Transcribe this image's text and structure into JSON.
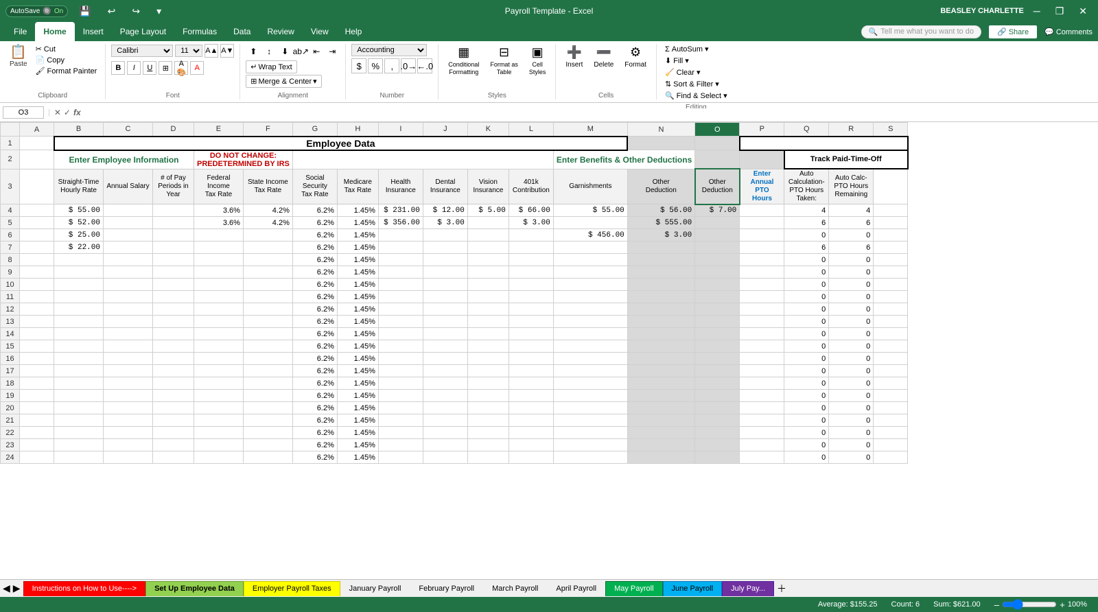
{
  "titlebar": {
    "autosave_label": "AutoSave",
    "autosave_state": "On",
    "title": "Payroll Template - Excel",
    "user": "BEASLEY CHARLETTE"
  },
  "tabs": [
    "File",
    "Home",
    "Insert",
    "Page Layout",
    "Formulas",
    "Data",
    "Review",
    "View",
    "Help"
  ],
  "active_tab": "Home",
  "search_placeholder": "Tell me what you want to do",
  "ribbon": {
    "clipboard": {
      "label": "Clipboard",
      "paste": "Paste",
      "cut": "Cut",
      "copy": "Copy",
      "format_painter": "Format Painter"
    },
    "font": {
      "label": "Font",
      "name": "Calibri",
      "size": "11"
    },
    "alignment": {
      "label": "Alignment",
      "wrap_text": "Wrap Text",
      "merge_center": "Merge & Center"
    },
    "number": {
      "label": "Number",
      "format": "Accounting"
    },
    "styles": {
      "label": "Styles",
      "conditional": "Conditional Formatting",
      "format_table": "Format as Table",
      "cell_styles": "Cell Styles"
    },
    "cells": {
      "label": "Cells",
      "insert": "Insert",
      "delete": "Delete",
      "format": "Format"
    },
    "editing": {
      "label": "Editing",
      "autosum": "AutoSum",
      "fill": "Fill",
      "clear": "Clear",
      "sort_filter": "Sort & Filter",
      "find_select": "Find & Select"
    }
  },
  "formula_bar": {
    "cell_ref": "O3",
    "formula": ""
  },
  "columns": [
    "B",
    "C",
    "D",
    "E",
    "F",
    "G",
    "H",
    "I",
    "J",
    "K",
    "L",
    "M",
    "N",
    "O",
    "P",
    "Q",
    "R",
    "S"
  ],
  "rows": [
    1,
    2,
    3,
    4,
    5,
    6,
    7,
    8,
    9,
    10,
    11,
    12,
    13,
    14,
    15,
    16,
    17,
    18,
    19,
    20,
    21,
    22,
    23,
    24
  ],
  "headers": {
    "row1": "Employee Data",
    "row2_left": "Enter Employee Information",
    "row2_mid": "DO NOT CHANGE: PREDETERMINED BY IRS",
    "row2_right": "Enter Benefits & Other Deductions",
    "row2_far_right": "Track Paid-Time-Off",
    "col_b": "Straight-Time Hourly Rate",
    "col_c": "Annual Salary",
    "col_d": "# of Pay Periods in Year",
    "col_e": "Federal Income Tax Rate",
    "col_f": "State Income Tax Rate",
    "col_g": "Social Security Tax Rate",
    "col_h": "Medicare Tax Rate",
    "col_i": "Health Insurance",
    "col_j": "Dental Insurance",
    "col_k": "Vision Insurance",
    "col_l": "401k Contribution",
    "col_m": "Garnishments",
    "col_n": "Other Deduction",
    "col_o": "Other Deduction",
    "col_p": "Enter Annual PTO Hours",
    "col_q": "Auto Calculation- PTO Hours Taken:",
    "col_r": "Auto Calc- PTO Hours Remaining"
  },
  "data_rows": [
    {
      "row": 4,
      "b": "$ 55.00",
      "c": "",
      "d": "",
      "e": "3.6%",
      "f": "4.2%",
      "g": "6.2%",
      "h": "1.45%",
      "i": "$ 231.00",
      "j": "$ 12.00",
      "k": "$ 5.00",
      "l": "$ 66.00",
      "m": "$ 55.00",
      "n": "$ 56.00",
      "o": "$ 7.00",
      "p": "",
      "q": "4",
      "r": "4"
    },
    {
      "row": 5,
      "b": "$ 52.00",
      "c": "",
      "d": "",
      "e": "3.6%",
      "f": "4.2%",
      "g": "6.2%",
      "h": "1.45%",
      "i": "$ 356.00",
      "j": "$ 3.00",
      "k": "",
      "l": "$ 3.00",
      "m": "",
      "n": "$ 555.00",
      "o": "",
      "p": "",
      "q": "6",
      "r": "6"
    },
    {
      "row": 6,
      "b": "$ 25.00",
      "c": "",
      "d": "",
      "e": "",
      "f": "",
      "g": "6.2%",
      "h": "1.45%",
      "i": "",
      "j": "",
      "k": "",
      "l": "",
      "m": "$ 456.00",
      "n": "$ 3.00",
      "o": "",
      "p": "",
      "q": "0",
      "r": "0"
    },
    {
      "row": 7,
      "b": "$ 22.00",
      "c": "",
      "d": "",
      "e": "",
      "f": "",
      "g": "6.2%",
      "h": "1.45%",
      "i": "",
      "j": "",
      "k": "",
      "l": "",
      "m": "",
      "n": "",
      "o": "",
      "p": "",
      "q": "6",
      "r": "6"
    },
    {
      "row": 8,
      "b": "",
      "c": "",
      "d": "",
      "e": "",
      "f": "",
      "g": "6.2%",
      "h": "1.45%",
      "i": "",
      "j": "",
      "k": "",
      "l": "",
      "m": "",
      "n": "",
      "o": "",
      "p": "",
      "q": "0",
      "r": "0"
    },
    {
      "row": 9,
      "b": "",
      "c": "",
      "d": "",
      "e": "",
      "f": "",
      "g": "6.2%",
      "h": "1.45%",
      "i": "",
      "j": "",
      "k": "",
      "l": "",
      "m": "",
      "n": "",
      "o": "",
      "p": "",
      "q": "0",
      "r": "0"
    },
    {
      "row": 10,
      "b": "",
      "c": "",
      "d": "",
      "e": "",
      "f": "",
      "g": "6.2%",
      "h": "1.45%",
      "i": "",
      "j": "",
      "k": "",
      "l": "",
      "m": "",
      "n": "",
      "o": "",
      "p": "",
      "q": "0",
      "r": "0"
    },
    {
      "row": 11,
      "b": "",
      "c": "",
      "d": "",
      "e": "",
      "f": "",
      "g": "6.2%",
      "h": "1.45%",
      "i": "",
      "j": "",
      "k": "",
      "l": "",
      "m": "",
      "n": "",
      "o": "",
      "p": "",
      "q": "0",
      "r": "0"
    },
    {
      "row": 12,
      "b": "",
      "c": "",
      "d": "",
      "e": "",
      "f": "",
      "g": "6.2%",
      "h": "1.45%",
      "i": "",
      "j": "",
      "k": "",
      "l": "",
      "m": "",
      "n": "",
      "o": "",
      "p": "",
      "q": "0",
      "r": "0"
    },
    {
      "row": 13,
      "b": "",
      "c": "",
      "d": "",
      "e": "",
      "f": "",
      "g": "6.2%",
      "h": "1.45%",
      "i": "",
      "j": "",
      "k": "",
      "l": "",
      "m": "",
      "n": "",
      "o": "",
      "p": "",
      "q": "0",
      "r": "0"
    },
    {
      "row": 14,
      "b": "",
      "c": "",
      "d": "",
      "e": "",
      "f": "",
      "g": "6.2%",
      "h": "1.45%",
      "i": "",
      "j": "",
      "k": "",
      "l": "",
      "m": "",
      "n": "",
      "o": "",
      "p": "",
      "q": "0",
      "r": "0"
    },
    {
      "row": 15,
      "b": "",
      "c": "",
      "d": "",
      "e": "",
      "f": "",
      "g": "6.2%",
      "h": "1.45%",
      "i": "",
      "j": "",
      "k": "",
      "l": "",
      "m": "",
      "n": "",
      "o": "",
      "p": "",
      "q": "0",
      "r": "0"
    },
    {
      "row": 16,
      "b": "",
      "c": "",
      "d": "",
      "e": "",
      "f": "",
      "g": "6.2%",
      "h": "1.45%",
      "i": "",
      "j": "",
      "k": "",
      "l": "",
      "m": "",
      "n": "",
      "o": "",
      "p": "",
      "q": "0",
      "r": "0"
    },
    {
      "row": 17,
      "b": "",
      "c": "",
      "d": "",
      "e": "",
      "f": "",
      "g": "6.2%",
      "h": "1.45%",
      "i": "",
      "j": "",
      "k": "",
      "l": "",
      "m": "",
      "n": "",
      "o": "",
      "p": "",
      "q": "0",
      "r": "0"
    },
    {
      "row": 18,
      "b": "",
      "c": "",
      "d": "",
      "e": "",
      "f": "",
      "g": "6.2%",
      "h": "1.45%",
      "i": "",
      "j": "",
      "k": "",
      "l": "",
      "m": "",
      "n": "",
      "o": "",
      "p": "",
      "q": "0",
      "r": "0"
    },
    {
      "row": 19,
      "b": "",
      "c": "",
      "d": "",
      "e": "",
      "f": "",
      "g": "6.2%",
      "h": "1.45%",
      "i": "",
      "j": "",
      "k": "",
      "l": "",
      "m": "",
      "n": "",
      "o": "",
      "p": "",
      "q": "0",
      "r": "0"
    },
    {
      "row": 20,
      "b": "",
      "c": "",
      "d": "",
      "e": "",
      "f": "",
      "g": "6.2%",
      "h": "1.45%",
      "i": "",
      "j": "",
      "k": "",
      "l": "",
      "m": "",
      "n": "",
      "o": "",
      "p": "",
      "q": "0",
      "r": "0"
    },
    {
      "row": 21,
      "b": "",
      "c": "",
      "d": "",
      "e": "",
      "f": "",
      "g": "6.2%",
      "h": "1.45%",
      "i": "",
      "j": "",
      "k": "",
      "l": "",
      "m": "",
      "n": "",
      "o": "",
      "p": "",
      "q": "0",
      "r": "0"
    },
    {
      "row": 22,
      "b": "",
      "c": "",
      "d": "",
      "e": "",
      "f": "",
      "g": "6.2%",
      "h": "1.45%",
      "i": "",
      "j": "",
      "k": "",
      "l": "",
      "m": "",
      "n": "",
      "o": "",
      "p": "",
      "q": "0",
      "r": "0"
    },
    {
      "row": 23,
      "b": "",
      "c": "",
      "d": "",
      "e": "",
      "f": "",
      "g": "6.2%",
      "h": "1.45%",
      "i": "",
      "j": "",
      "k": "",
      "l": "",
      "m": "",
      "n": "",
      "o": "",
      "p": "",
      "q": "0",
      "r": "0"
    },
    {
      "row": 24,
      "b": "",
      "c": "",
      "d": "",
      "e": "",
      "f": "",
      "g": "6.2%",
      "h": "1.45%",
      "i": "",
      "j": "",
      "k": "",
      "l": "",
      "m": "",
      "n": "",
      "o": "",
      "p": "",
      "q": "0",
      "r": "0"
    }
  ],
  "sheet_tabs": [
    {
      "label": "Instructions on How to Use---->",
      "color": "red",
      "active": false
    },
    {
      "label": "Set Up Employee Data",
      "color": "green",
      "active": true
    },
    {
      "label": "Employer Payroll Taxes",
      "color": "yellow",
      "active": false
    },
    {
      "label": "January Payroll",
      "color": "none",
      "active": false
    },
    {
      "label": "February Payroll",
      "color": "none",
      "active": false
    },
    {
      "label": "March Payroll",
      "color": "none",
      "active": false
    },
    {
      "label": "April Payroll",
      "color": "none",
      "active": false
    },
    {
      "label": "May Payroll",
      "color": "dark-green",
      "active": false
    },
    {
      "label": "June Payroll",
      "color": "blue",
      "active": false
    },
    {
      "label": "July Pay...",
      "color": "violet",
      "active": false
    }
  ],
  "status_bar": {
    "average": "Average: $155.25",
    "count": "Count: 6",
    "sum": "Sum: $621.00"
  }
}
